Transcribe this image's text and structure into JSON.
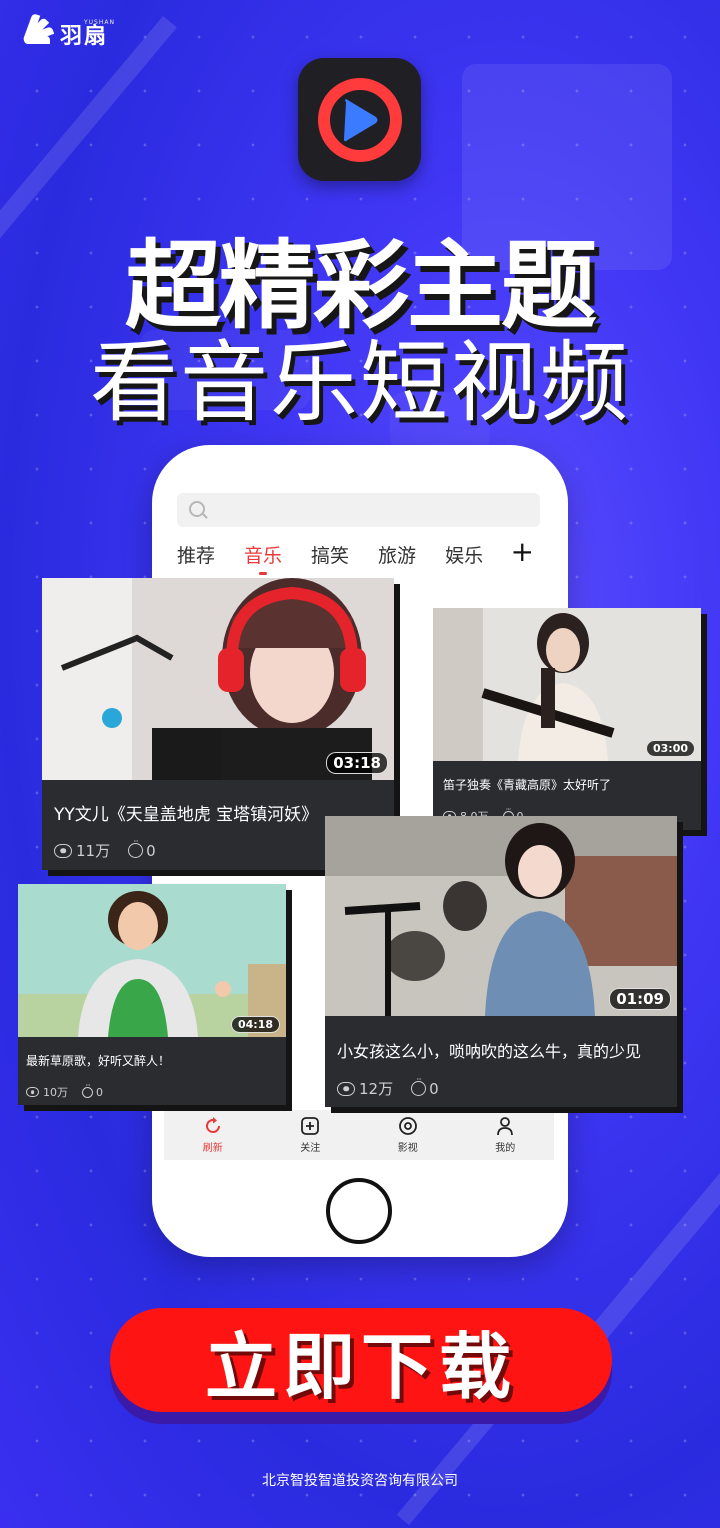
{
  "brand": {
    "small_text": "YUSHAN",
    "name": "羽扇",
    "logo_icon": "fan-wings-icon"
  },
  "app_icon": {
    "icon": "play-button-icon",
    "ring_color": "#ff3b3b",
    "play_color": "#3a7bff"
  },
  "headline": {
    "line1": "超精彩主题",
    "line2": "看音乐短视频"
  },
  "phone": {
    "search_placeholder": "",
    "tabs": [
      "推荐",
      "音乐",
      "搞笑",
      "旅游",
      "娱乐"
    ],
    "active_tab": "音乐",
    "add_tab": "+",
    "bottom_nav": [
      {
        "label": "刷新",
        "icon": "refresh-icon",
        "active": true
      },
      {
        "label": "关注",
        "icon": "add-square-icon",
        "active": false
      },
      {
        "label": "影视",
        "icon": "film-reel-icon",
        "active": false
      },
      {
        "label": "我的",
        "icon": "person-icon",
        "active": false
      }
    ]
  },
  "videos": [
    {
      "title": "YY文儿《天皇盖地虎 宝塔镇河妖》",
      "duration": "03:18",
      "views": "11万",
      "comments": "0"
    },
    {
      "title": "笛子独奏《青藏高原》太好听了",
      "duration": "03:00",
      "views": "8.0万",
      "comments": "0"
    },
    {
      "title": "最新草原歌，好听又醉人！",
      "duration": "04:18",
      "views": "10万",
      "comments": "0"
    },
    {
      "title": "小女孩这么小，唢呐吹的这么牛，真的少见",
      "duration": "01:09",
      "views": "12万",
      "comments": "0"
    }
  ],
  "cta": {
    "label": "立即下载"
  },
  "footer": {
    "company": "北京智投智道投资咨询有限公司"
  },
  "colors": {
    "background": "#3f36f4",
    "accent_red": "#ff1414",
    "card_bg": "#2b2c30"
  }
}
